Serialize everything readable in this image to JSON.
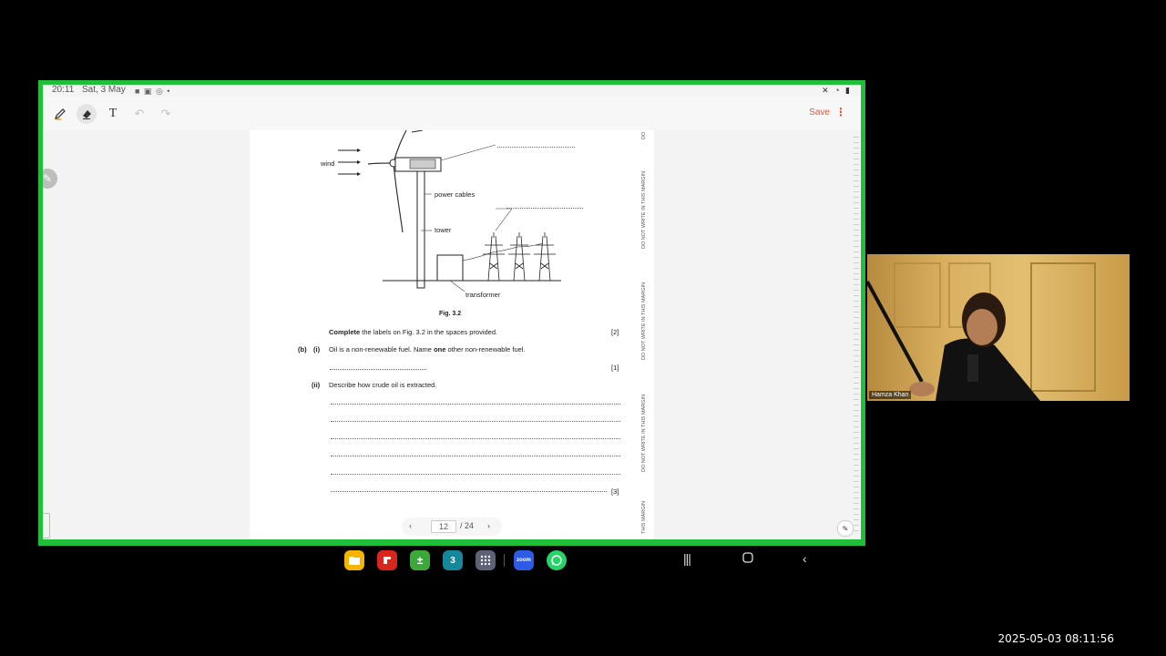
{
  "status_bar": {
    "time": "20:11",
    "date": "Sat, 3 May"
  },
  "toolbar": {
    "save_label": "Save",
    "more_label": "⋮",
    "text_tool_label": "T"
  },
  "pdf": {
    "wind_label": "wind",
    "power_cables_label": "power cables",
    "tower_label": "tower",
    "transformer_label": "transformer",
    "fig_caption": "Fig. 3.2",
    "q_complete_bold": "Complete",
    "q_complete_rest": " the labels on Fig. 3.2 in the spaces provided.",
    "mark_2": "[2]",
    "part_b": "(b)",
    "part_i": "(i)",
    "q_b_i_pre": "Oil is a non-renewable fuel. Name ",
    "q_b_i_bold": "one",
    "q_b_i_post": " other non-renewable fuel.",
    "mark_1": "[1]",
    "part_ii": "(ii)",
    "q_b_ii": "Describe how crude oil is extracted.",
    "mark_3": "[3]",
    "margin_top": "DO",
    "margin_text": "DO NOT WRITE IN THIS MARGIN",
    "margin_bottom": "THIS MARGIN"
  },
  "page_nav": {
    "current": "12",
    "total": "/ 24"
  },
  "dock": {
    "apps": [
      "files-icon",
      "flipboard-icon",
      "calculator-icon",
      "calendar-icon",
      "app-drawer-icon",
      "zoom-icon",
      "whatsapp-icon"
    ],
    "calendar_day": "3",
    "zoom_text": "zoom"
  },
  "webcam": {
    "participant_name": "Hamza Khan"
  },
  "recording_timestamp": "2025-05-03 08:11:56"
}
